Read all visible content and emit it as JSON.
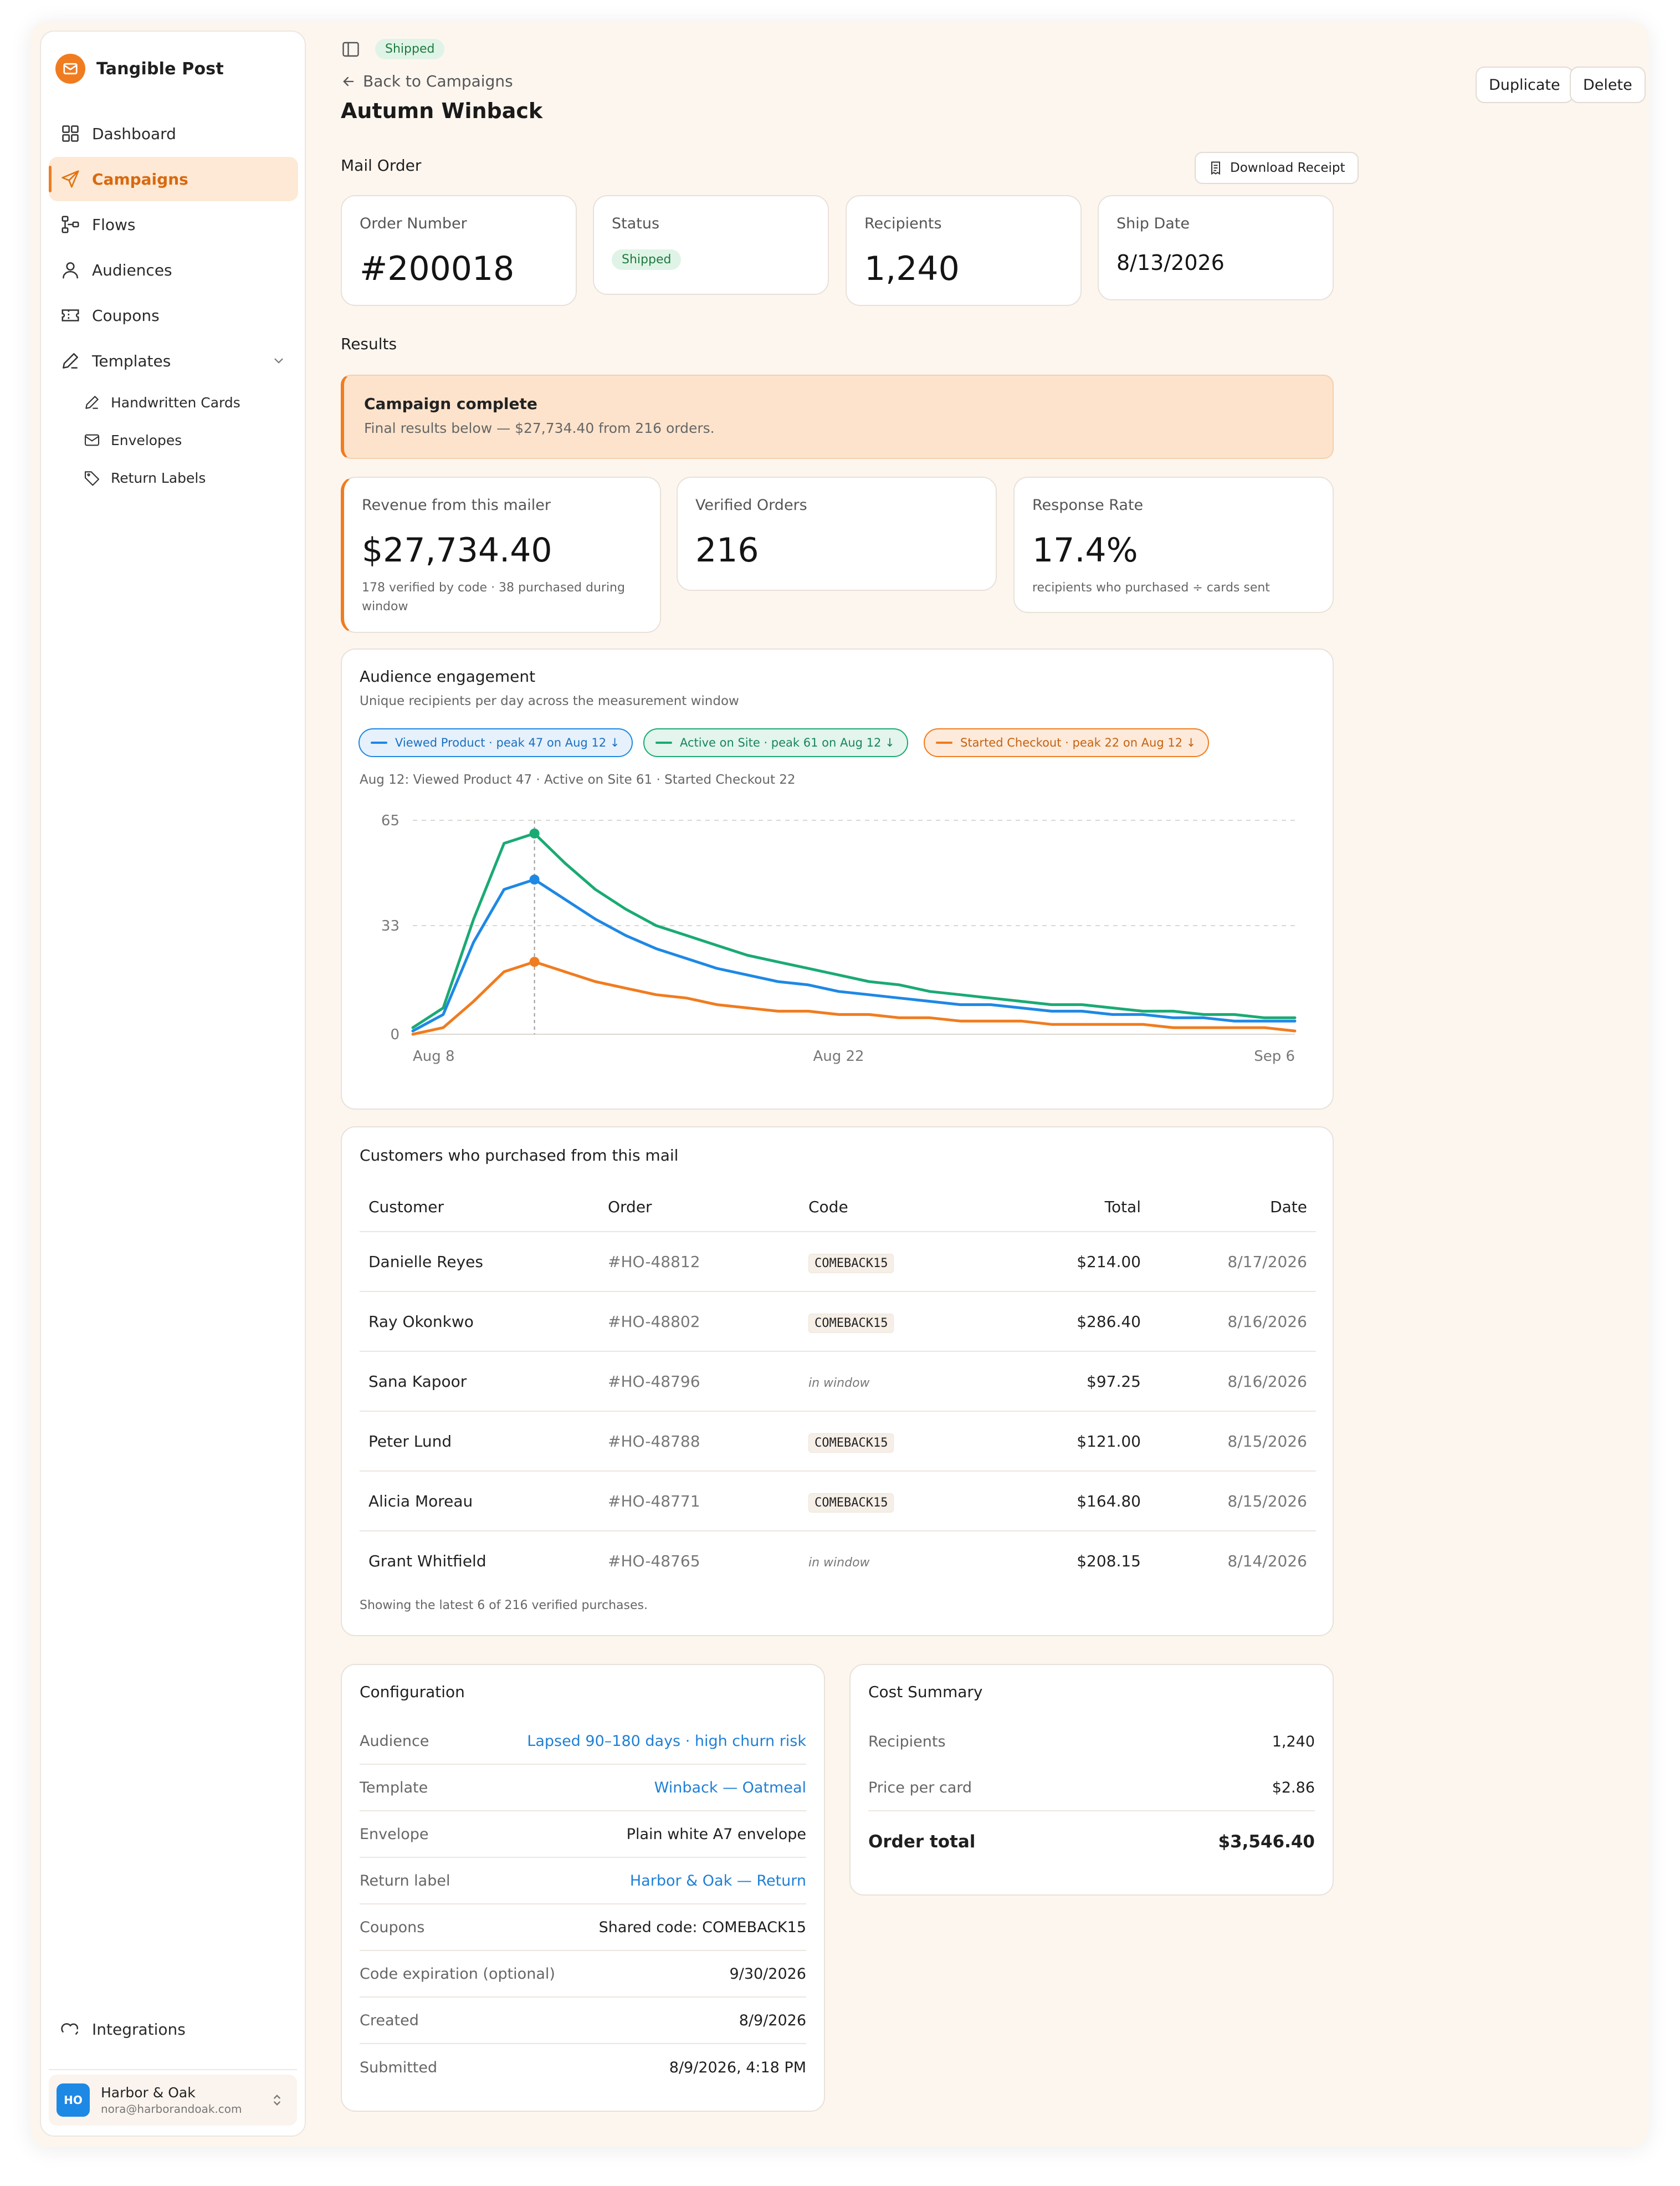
{
  "brand": {
    "name": "Tangible Post",
    "accent": "#f07c1f"
  },
  "sidebar": {
    "items": [
      {
        "id": "dashboard",
        "label": "Dashboard",
        "icon": "grid-icon"
      },
      {
        "id": "campaigns",
        "label": "Campaigns",
        "icon": "send-icon",
        "active": true
      },
      {
        "id": "flows",
        "label": "Flows",
        "icon": "flow-icon"
      },
      {
        "id": "audiences",
        "label": "Audiences",
        "icon": "user-icon"
      },
      {
        "id": "coupons",
        "label": "Coupons",
        "icon": "ticket-icon"
      },
      {
        "id": "templates",
        "label": "Templates",
        "icon": "pen-icon",
        "expanded": true
      }
    ],
    "templates_children": [
      {
        "label": "Handwritten Cards",
        "icon": "pen-icon"
      },
      {
        "label": "Envelopes",
        "icon": "envelope-icon"
      },
      {
        "label": "Return Labels",
        "icon": "tag-icon"
      }
    ],
    "integrations_label": "Integrations",
    "account": {
      "initials": "HO",
      "name": "Harbor & Oak",
      "email": "nora@harborandoak.com"
    }
  },
  "header": {
    "status_pill": "Shipped",
    "back_label": "Back to Campaigns",
    "title": "Autumn Winback",
    "duplicate_label": "Duplicate",
    "delete_label": "Delete"
  },
  "mail_order": {
    "section_label": "Mail Order",
    "download_label": "Download Receipt",
    "order_number_label": "Order Number",
    "order_number": "#200018",
    "status_label": "Status",
    "status": "Shipped",
    "recipients_label": "Recipients",
    "recipients": "1,240",
    "ship_date_label": "Ship Date",
    "ship_date": "8/13/2026"
  },
  "results": {
    "section_label": "Results",
    "banner_title": "Campaign complete",
    "banner_sub": "Final results below — $27,734.40 from 216 orders.",
    "revenue_label": "Revenue from this mailer",
    "revenue": "$27,734.40",
    "revenue_sub": "178 verified by code · 38 purchased during window",
    "orders_label": "Verified Orders",
    "orders": "216",
    "response_label": "Response Rate",
    "response": "17.4%",
    "response_sub": "recipients who purchased ÷ cards sent"
  },
  "engagement": {
    "title": "Audience engagement",
    "subtitle": "Unique recipients per day across the measurement window",
    "chips": [
      {
        "label": "Viewed Product · peak 47 on Aug 12 ↓",
        "color": "#1e88e5"
      },
      {
        "label": "Active on Site · peak 61 on Aug 12 ↓",
        "color": "#1aaa74"
      },
      {
        "label": "Started Checkout · peak 22 on Aug 12 ↓",
        "color": "#f07c1f"
      }
    ],
    "hover_readout": "Aug 12: Viewed Product 47 · Active on Site 61 · Started Checkout 22"
  },
  "chart_data": {
    "type": "line",
    "x": [
      "Aug 8",
      "Aug 9",
      "Aug 10",
      "Aug 11",
      "Aug 12",
      "Aug 13",
      "Aug 14",
      "Aug 15",
      "Aug 16",
      "Aug 17",
      "Aug 18",
      "Aug 19",
      "Aug 20",
      "Aug 21",
      "Aug 22",
      "Aug 23",
      "Aug 24",
      "Aug 25",
      "Aug 26",
      "Aug 27",
      "Aug 28",
      "Aug 29",
      "Aug 30",
      "Aug 31",
      "Sep 1",
      "Sep 2",
      "Sep 3",
      "Sep 4",
      "Sep 5",
      "Sep 6"
    ],
    "x_ticks": [
      "Aug 8",
      "Aug 22",
      "Sep 6"
    ],
    "y_ticks": [
      0,
      33,
      65
    ],
    "ylim": [
      0,
      65
    ],
    "highlight_x": "Aug 12",
    "grid": "horizontal dashed",
    "series": [
      {
        "name": "Active on Site",
        "color": "#1aaa74",
        "values": [
          2,
          8,
          35,
          58,
          61,
          52,
          44,
          38,
          33,
          30,
          27,
          24,
          22,
          20,
          18,
          16,
          15,
          13,
          12,
          11,
          10,
          9,
          9,
          8,
          7,
          7,
          6,
          6,
          5,
          5
        ]
      },
      {
        "name": "Viewed Product",
        "color": "#1e88e5",
        "values": [
          1,
          6,
          28,
          44,
          47,
          41,
          35,
          30,
          26,
          23,
          20,
          18,
          16,
          15,
          13,
          12,
          11,
          10,
          9,
          9,
          8,
          7,
          7,
          6,
          6,
          5,
          5,
          4,
          4,
          4
        ]
      },
      {
        "name": "Started Checkout",
        "color": "#f07c1f",
        "values": [
          0,
          2,
          10,
          19,
          22,
          19,
          16,
          14,
          12,
          11,
          9,
          8,
          7,
          7,
          6,
          6,
          5,
          5,
          4,
          4,
          4,
          3,
          3,
          3,
          3,
          2,
          2,
          2,
          2,
          1
        ]
      }
    ]
  },
  "purchases": {
    "title": "Customers who purchased from this mail",
    "columns": [
      "Customer",
      "Order",
      "Code",
      "Total",
      "Date"
    ],
    "rows": [
      {
        "customer": "Danielle Reyes",
        "order": "#HO-48812",
        "code": "COMEBACK15",
        "total": "$214.00",
        "date": "8/17/2026"
      },
      {
        "customer": "Ray Okonkwo",
        "order": "#HO-48802",
        "code": "COMEBACK15",
        "total": "$286.40",
        "date": "8/16/2026"
      },
      {
        "customer": "Sana Kapoor",
        "order": "#HO-48796",
        "code": "in window",
        "total": "$97.25",
        "date": "8/16/2026"
      },
      {
        "customer": "Peter Lund",
        "order": "#HO-48788",
        "code": "COMEBACK15",
        "total": "$121.00",
        "date": "8/15/2026"
      },
      {
        "customer": "Alicia Moreau",
        "order": "#HO-48771",
        "code": "COMEBACK15",
        "total": "$164.80",
        "date": "8/15/2026"
      },
      {
        "customer": "Grant Whitfield",
        "order": "#HO-48765",
        "code": "in window",
        "total": "$208.15",
        "date": "8/14/2026"
      }
    ],
    "footer": "Showing the latest 6 of 216 verified purchases."
  },
  "configuration": {
    "title": "Configuration",
    "rows": [
      {
        "k": "Audience",
        "v": "Lapsed 90–180 days · high churn risk",
        "link": true
      },
      {
        "k": "Template",
        "v": "Winback — Oatmeal",
        "link": true
      },
      {
        "k": "Envelope",
        "v": "Plain white A7 envelope",
        "link": false
      },
      {
        "k": "Return label",
        "v": "Harbor & Oak — Return",
        "link": true
      },
      {
        "k": "Coupons",
        "v": "Shared code: COMEBACK15",
        "link": false
      },
      {
        "k": "Code expiration (optional)",
        "v": "9/30/2026",
        "link": false
      },
      {
        "k": "Created",
        "v": "8/9/2026",
        "link": false
      },
      {
        "k": "Submitted",
        "v": "8/9/2026, 4:18 PM",
        "link": false
      }
    ]
  },
  "cost_summary": {
    "title": "Cost Summary",
    "recipients_label": "Recipients",
    "recipients": "1,240",
    "price_label": "Price per card",
    "price": "$2.86",
    "total_label": "Order total",
    "total": "$3,546.40"
  }
}
